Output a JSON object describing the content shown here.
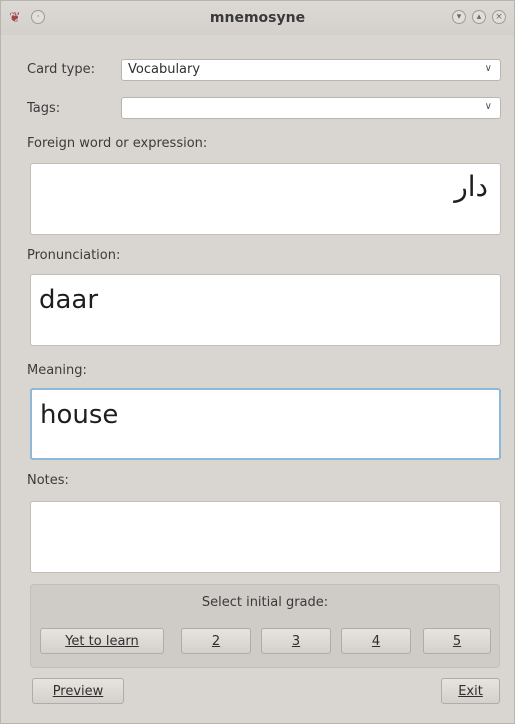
{
  "window": {
    "title": "mnemosyne"
  },
  "card_type": {
    "label": "Card type:",
    "value": "Vocabulary"
  },
  "tags": {
    "label": "Tags:",
    "value": ""
  },
  "foreign": {
    "label": "Foreign word or expression:",
    "value": "دار"
  },
  "pronunciation": {
    "label": "Pronunciation:",
    "value": "daar"
  },
  "meaning": {
    "label": "Meaning:",
    "value": "house"
  },
  "notes": {
    "label": "Notes:",
    "value": ""
  },
  "grade": {
    "title": "Select initial grade:",
    "buttons": [
      "Yet to learn",
      "2",
      "3",
      "4",
      "5"
    ]
  },
  "buttons": {
    "preview": "Preview",
    "exit": "Exit"
  }
}
